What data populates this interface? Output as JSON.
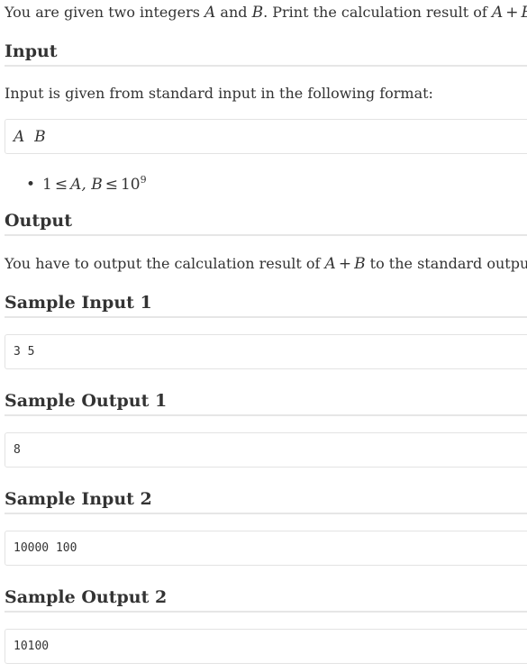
{
  "statement": {
    "text_prefix": "You are given two integers",
    "var_a": "A",
    "and": "and",
    "var_b": "B",
    "text_mid": ". Print the calculation result of",
    "expr_a": "A",
    "plus": "+",
    "expr_b": "B",
    "end": "."
  },
  "input": {
    "heading": "Input",
    "desc": "Input is given from standard input in the following format:",
    "format": "A  B",
    "constraint": {
      "one": "1",
      "le1": "≤",
      "vars": "A, B",
      "le2": "≤",
      "ten": "10",
      "exp": "9"
    }
  },
  "output": {
    "heading": "Output",
    "desc_prefix": "You have to output the calculation result of",
    "expr_a": "A",
    "plus": "+",
    "expr_b": "B",
    "desc_suffix": "to the standard output."
  },
  "samples": [
    {
      "heading": "Sample Input 1",
      "value": "3 5"
    },
    {
      "heading": "Sample Output 1",
      "value": "8"
    },
    {
      "heading": "Sample Input 2",
      "value": "10000 100"
    },
    {
      "heading": "Sample Output 2",
      "value": "10100"
    }
  ]
}
